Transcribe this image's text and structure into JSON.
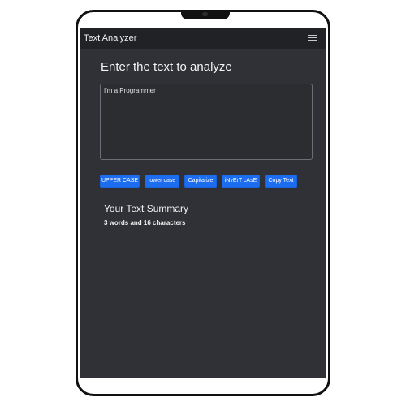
{
  "navbar": {
    "brand": "Text Analyzer",
    "menu_icon": "hamburger-menu-icon"
  },
  "main": {
    "heading": "Enter the text to analyze",
    "textarea_value": "I'm a Programmer"
  },
  "buttons": [
    {
      "label": "UPPER CASE"
    },
    {
      "label": "lower case"
    },
    {
      "label": "Capitalize"
    },
    {
      "label": "iNvErT cAsE"
    },
    {
      "label": "Copy Text"
    }
  ],
  "summary": {
    "title": "Your Text Summary",
    "text": "3 words and 16 characters"
  },
  "colors": {
    "button_primary": "#1c6df0",
    "background": "#2f3136",
    "navbar": "#202226"
  }
}
